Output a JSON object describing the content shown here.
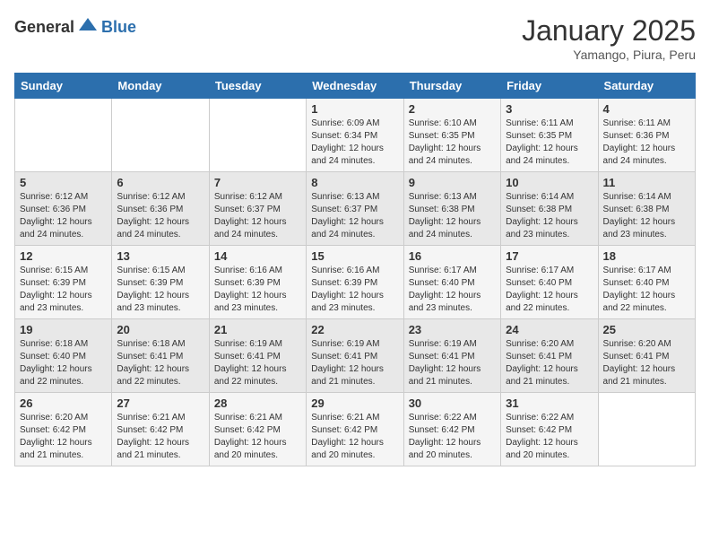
{
  "header": {
    "logo_general": "General",
    "logo_blue": "Blue",
    "month": "January 2025",
    "location": "Yamango, Piura, Peru"
  },
  "weekdays": [
    "Sunday",
    "Monday",
    "Tuesday",
    "Wednesday",
    "Thursday",
    "Friday",
    "Saturday"
  ],
  "weeks": [
    [
      {
        "day": "",
        "sunrise": "",
        "sunset": "",
        "daylight": ""
      },
      {
        "day": "",
        "sunrise": "",
        "sunset": "",
        "daylight": ""
      },
      {
        "day": "",
        "sunrise": "",
        "sunset": "",
        "daylight": ""
      },
      {
        "day": "1",
        "sunrise": "Sunrise: 6:09 AM",
        "sunset": "Sunset: 6:34 PM",
        "daylight": "Daylight: 12 hours and 24 minutes."
      },
      {
        "day": "2",
        "sunrise": "Sunrise: 6:10 AM",
        "sunset": "Sunset: 6:35 PM",
        "daylight": "Daylight: 12 hours and 24 minutes."
      },
      {
        "day": "3",
        "sunrise": "Sunrise: 6:11 AM",
        "sunset": "Sunset: 6:35 PM",
        "daylight": "Daylight: 12 hours and 24 minutes."
      },
      {
        "day": "4",
        "sunrise": "Sunrise: 6:11 AM",
        "sunset": "Sunset: 6:36 PM",
        "daylight": "Daylight: 12 hours and 24 minutes."
      }
    ],
    [
      {
        "day": "5",
        "sunrise": "Sunrise: 6:12 AM",
        "sunset": "Sunset: 6:36 PM",
        "daylight": "Daylight: 12 hours and 24 minutes."
      },
      {
        "day": "6",
        "sunrise": "Sunrise: 6:12 AM",
        "sunset": "Sunset: 6:36 PM",
        "daylight": "Daylight: 12 hours and 24 minutes."
      },
      {
        "day": "7",
        "sunrise": "Sunrise: 6:12 AM",
        "sunset": "Sunset: 6:37 PM",
        "daylight": "Daylight: 12 hours and 24 minutes."
      },
      {
        "day": "8",
        "sunrise": "Sunrise: 6:13 AM",
        "sunset": "Sunset: 6:37 PM",
        "daylight": "Daylight: 12 hours and 24 minutes."
      },
      {
        "day": "9",
        "sunrise": "Sunrise: 6:13 AM",
        "sunset": "Sunset: 6:38 PM",
        "daylight": "Daylight: 12 hours and 24 minutes."
      },
      {
        "day": "10",
        "sunrise": "Sunrise: 6:14 AM",
        "sunset": "Sunset: 6:38 PM",
        "daylight": "Daylight: 12 hours and 23 minutes."
      },
      {
        "day": "11",
        "sunrise": "Sunrise: 6:14 AM",
        "sunset": "Sunset: 6:38 PM",
        "daylight": "Daylight: 12 hours and 23 minutes."
      }
    ],
    [
      {
        "day": "12",
        "sunrise": "Sunrise: 6:15 AM",
        "sunset": "Sunset: 6:39 PM",
        "daylight": "Daylight: 12 hours and 23 minutes."
      },
      {
        "day": "13",
        "sunrise": "Sunrise: 6:15 AM",
        "sunset": "Sunset: 6:39 PM",
        "daylight": "Daylight: 12 hours and 23 minutes."
      },
      {
        "day": "14",
        "sunrise": "Sunrise: 6:16 AM",
        "sunset": "Sunset: 6:39 PM",
        "daylight": "Daylight: 12 hours and 23 minutes."
      },
      {
        "day": "15",
        "sunrise": "Sunrise: 6:16 AM",
        "sunset": "Sunset: 6:39 PM",
        "daylight": "Daylight: 12 hours and 23 minutes."
      },
      {
        "day": "16",
        "sunrise": "Sunrise: 6:17 AM",
        "sunset": "Sunset: 6:40 PM",
        "daylight": "Daylight: 12 hours and 23 minutes."
      },
      {
        "day": "17",
        "sunrise": "Sunrise: 6:17 AM",
        "sunset": "Sunset: 6:40 PM",
        "daylight": "Daylight: 12 hours and 22 minutes."
      },
      {
        "day": "18",
        "sunrise": "Sunrise: 6:17 AM",
        "sunset": "Sunset: 6:40 PM",
        "daylight": "Daylight: 12 hours and 22 minutes."
      }
    ],
    [
      {
        "day": "19",
        "sunrise": "Sunrise: 6:18 AM",
        "sunset": "Sunset: 6:40 PM",
        "daylight": "Daylight: 12 hours and 22 minutes."
      },
      {
        "day": "20",
        "sunrise": "Sunrise: 6:18 AM",
        "sunset": "Sunset: 6:41 PM",
        "daylight": "Daylight: 12 hours and 22 minutes."
      },
      {
        "day": "21",
        "sunrise": "Sunrise: 6:19 AM",
        "sunset": "Sunset: 6:41 PM",
        "daylight": "Daylight: 12 hours and 22 minutes."
      },
      {
        "day": "22",
        "sunrise": "Sunrise: 6:19 AM",
        "sunset": "Sunset: 6:41 PM",
        "daylight": "Daylight: 12 hours and 21 minutes."
      },
      {
        "day": "23",
        "sunrise": "Sunrise: 6:19 AM",
        "sunset": "Sunset: 6:41 PM",
        "daylight": "Daylight: 12 hours and 21 minutes."
      },
      {
        "day": "24",
        "sunrise": "Sunrise: 6:20 AM",
        "sunset": "Sunset: 6:41 PM",
        "daylight": "Daylight: 12 hours and 21 minutes."
      },
      {
        "day": "25",
        "sunrise": "Sunrise: 6:20 AM",
        "sunset": "Sunset: 6:41 PM",
        "daylight": "Daylight: 12 hours and 21 minutes."
      }
    ],
    [
      {
        "day": "26",
        "sunrise": "Sunrise: 6:20 AM",
        "sunset": "Sunset: 6:42 PM",
        "daylight": "Daylight: 12 hours and 21 minutes."
      },
      {
        "day": "27",
        "sunrise": "Sunrise: 6:21 AM",
        "sunset": "Sunset: 6:42 PM",
        "daylight": "Daylight: 12 hours and 21 minutes."
      },
      {
        "day": "28",
        "sunrise": "Sunrise: 6:21 AM",
        "sunset": "Sunset: 6:42 PM",
        "daylight": "Daylight: 12 hours and 20 minutes."
      },
      {
        "day": "29",
        "sunrise": "Sunrise: 6:21 AM",
        "sunset": "Sunset: 6:42 PM",
        "daylight": "Daylight: 12 hours and 20 minutes."
      },
      {
        "day": "30",
        "sunrise": "Sunrise: 6:22 AM",
        "sunset": "Sunset: 6:42 PM",
        "daylight": "Daylight: 12 hours and 20 minutes."
      },
      {
        "day": "31",
        "sunrise": "Sunrise: 6:22 AM",
        "sunset": "Sunset: 6:42 PM",
        "daylight": "Daylight: 12 hours and 20 minutes."
      },
      {
        "day": "",
        "sunrise": "",
        "sunset": "",
        "daylight": ""
      }
    ]
  ]
}
